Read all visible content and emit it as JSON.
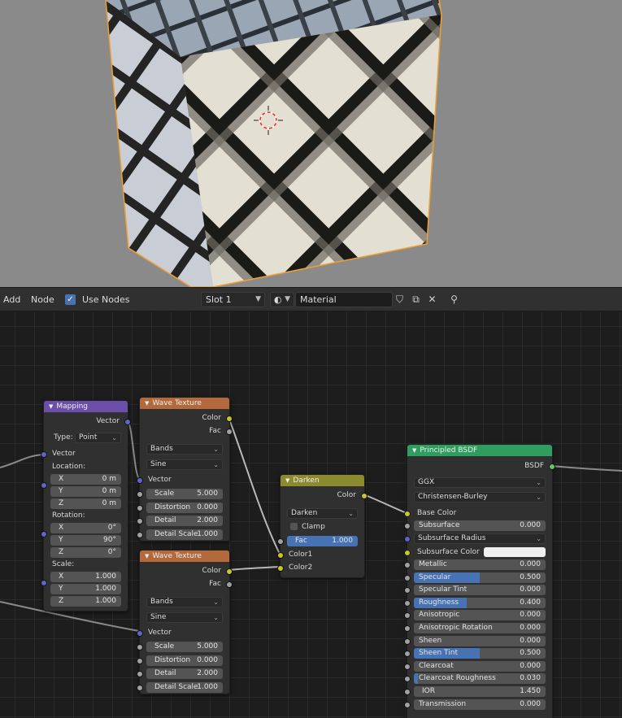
{
  "header": {
    "add": "Add",
    "node": "Node",
    "use_nodes": "Use Nodes",
    "use_nodes_checked": true,
    "slot": "Slot 1",
    "material": "Material",
    "icons": [
      "sphere-material-icon",
      "shield-icon",
      "copy-icon",
      "close-icon",
      "pin-icon"
    ]
  },
  "nodes": {
    "mapping": {
      "title": "Mapping",
      "color": "#6c4fa8",
      "out_vector": "Vector",
      "type_label": "Type:",
      "type_value": "Point",
      "in_vector": "Vector",
      "location_label": "Location:",
      "location": [
        {
          "l": "X",
          "v": "0 m"
        },
        {
          "l": "Y",
          "v": "0 m"
        },
        {
          "l": "Z",
          "v": "0 m"
        }
      ],
      "rotation_label": "Rotation:",
      "rotation": [
        {
          "l": "X",
          "v": "0°"
        },
        {
          "l": "Y",
          "v": "90°"
        },
        {
          "l": "Z",
          "v": "0°"
        }
      ],
      "scale_label": "Scale:",
      "scale": [
        {
          "l": "X",
          "v": "1.000"
        },
        {
          "l": "Y",
          "v": "1.000"
        },
        {
          "l": "Z",
          "v": "1.000"
        }
      ]
    },
    "wave1": {
      "title": "Wave Texture",
      "color": "#b3693c",
      "out_color": "Color",
      "out_fac": "Fac",
      "type": "Bands",
      "profile": "Sine",
      "in_vector": "Vector",
      "fields": [
        {
          "l": "Scale",
          "v": "5.000"
        },
        {
          "l": "Distortion",
          "v": "0.000"
        },
        {
          "l": "Detail",
          "v": "2.000"
        },
        {
          "l": "Detail Scale",
          "v": "1.000"
        }
      ]
    },
    "wave2": {
      "title": "Wave Texture",
      "color": "#b3693c",
      "out_color": "Color",
      "out_fac": "Fac",
      "type": "Bands",
      "profile": "Sine",
      "in_vector": "Vector",
      "fields": [
        {
          "l": "Scale",
          "v": "5.000"
        },
        {
          "l": "Distortion",
          "v": "0.000"
        },
        {
          "l": "Detail",
          "v": "2.000"
        },
        {
          "l": "Detail Scale",
          "v": "1.000"
        }
      ]
    },
    "darken": {
      "title": "Darken",
      "color": "#8c8a2e",
      "out_color": "Color",
      "blend": "Darken",
      "clamp": "Clamp",
      "fac_label": "Fac",
      "fac_value": "1.000",
      "in_color1": "Color1",
      "in_color2": "Color2"
    },
    "bsdf": {
      "title": "Principled BSDF",
      "color": "#2e9e5e",
      "out_bsdf": "BSDF",
      "distribution": "GGX",
      "subsurface_method": "Christensen-Burley",
      "base_color": "Base Color",
      "subsurface": {
        "l": "Subsurface",
        "v": "0.000"
      },
      "subsurface_radius": "Subsurface Radius",
      "subsurface_color": "Subsurface Color",
      "params": [
        {
          "l": "Metallic",
          "v": "0.000",
          "f": 0
        },
        {
          "l": "Specular",
          "v": "0.500",
          "f": 0.5
        },
        {
          "l": "Specular Tint",
          "v": "0.000",
          "f": 0
        },
        {
          "l": "Roughness",
          "v": "0.400",
          "f": 0.4
        },
        {
          "l": "Anisotropic",
          "v": "0.000",
          "f": 0
        },
        {
          "l": "Anisotropic Rotation",
          "v": "0.000",
          "f": 0
        },
        {
          "l": "Sheen",
          "v": "0.000",
          "f": 0
        },
        {
          "l": "Sheen Tint",
          "v": "0.500",
          "f": 0.5
        },
        {
          "l": "Clearcoat",
          "v": "0.000",
          "f": 0
        },
        {
          "l": "Clearcoat Roughness",
          "v": "0.030",
          "f": 0.03
        },
        {
          "l": "IOR",
          "v": "1.450",
          "f": 0
        },
        {
          "l": "Transmission",
          "v": "0.000",
          "f": 0
        }
      ]
    }
  }
}
